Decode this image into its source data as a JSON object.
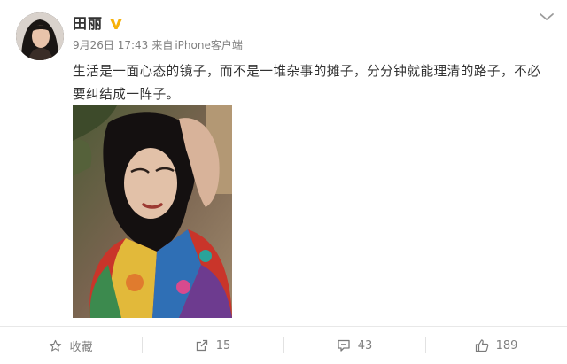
{
  "post": {
    "username": "田丽",
    "date": "9月26日 17:43",
    "source_prefix": "来自",
    "source": "iPhone客户端",
    "text": "生活是一面心态的镜子，而不是一堆杂事的摊子，分分钟就能理清的路子，不必要纠结成一阵子。"
  },
  "icons": {
    "avatar": "avatar-portrait",
    "verified": "vip-v-badge",
    "collapse": "chevron-down-icon",
    "favorite": "star-icon",
    "repost": "repost-icon",
    "comment": "comment-icon",
    "like": "thumbs-up-icon"
  },
  "actions": {
    "favorite_label": "收藏",
    "repost_count": "15",
    "comment_count": "43",
    "like_count": "189"
  },
  "colors": {
    "text": "#333333",
    "meta": "#808080",
    "badge": "#f6b10a",
    "divider": "#e8e8e8"
  }
}
